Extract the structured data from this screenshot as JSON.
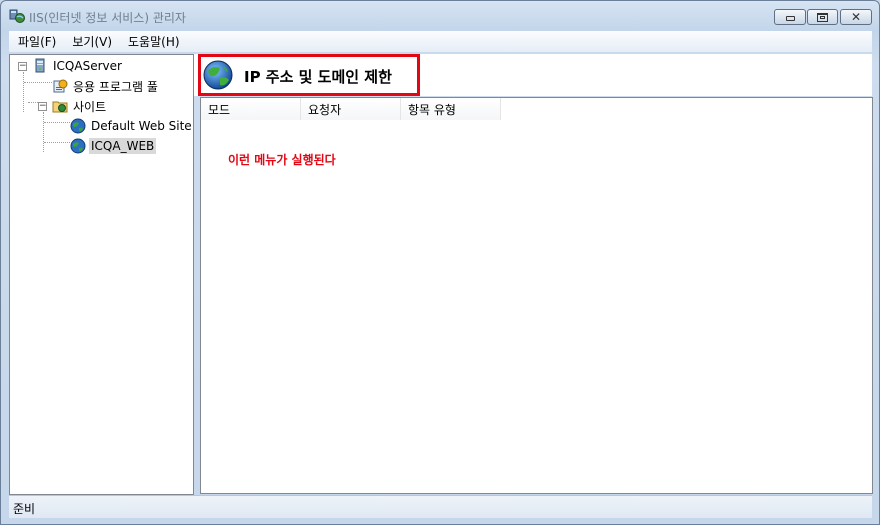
{
  "window": {
    "title": "IIS(인터넷 정보 서비스) 관리자",
    "icons": {
      "app": "iis-manager-icon",
      "minimize": "minimize-icon",
      "maximize": "maximize-icon",
      "close": "close-icon"
    }
  },
  "menu": {
    "items": [
      {
        "label": "파일(F)"
      },
      {
        "label": "보기(V)"
      },
      {
        "label": "도움말(H)"
      }
    ]
  },
  "tree": {
    "server": {
      "label": "ICQAServer",
      "icon": "server-icon",
      "expanded": true
    },
    "app_pool": {
      "label": "응용 프로그램 풀",
      "icon": "app-pool-icon"
    },
    "sites": {
      "label": "사이트",
      "icon": "sites-folder-icon",
      "expanded": true
    },
    "site_default": {
      "label": "Default Web Site",
      "icon": "globe-icon"
    },
    "site_icqa": {
      "label": "ICQA_WEB",
      "icon": "globe-icon",
      "selected": true
    }
  },
  "feature": {
    "title": "IP 주소 및 도메인 제한",
    "icon": "globe-icon"
  },
  "list": {
    "columns": [
      {
        "label": "모드"
      },
      {
        "label": "요청자"
      },
      {
        "label": "항목 유형"
      }
    ],
    "rows": []
  },
  "annotation": {
    "text": "이런 메뉴가 실행된다",
    "highlight_color": "#e30613"
  },
  "status": {
    "text": "준비"
  },
  "colors": {
    "window_chrome": "#c9d9ea",
    "accent_red": "#e30613",
    "selection": "#d9d9d9"
  }
}
